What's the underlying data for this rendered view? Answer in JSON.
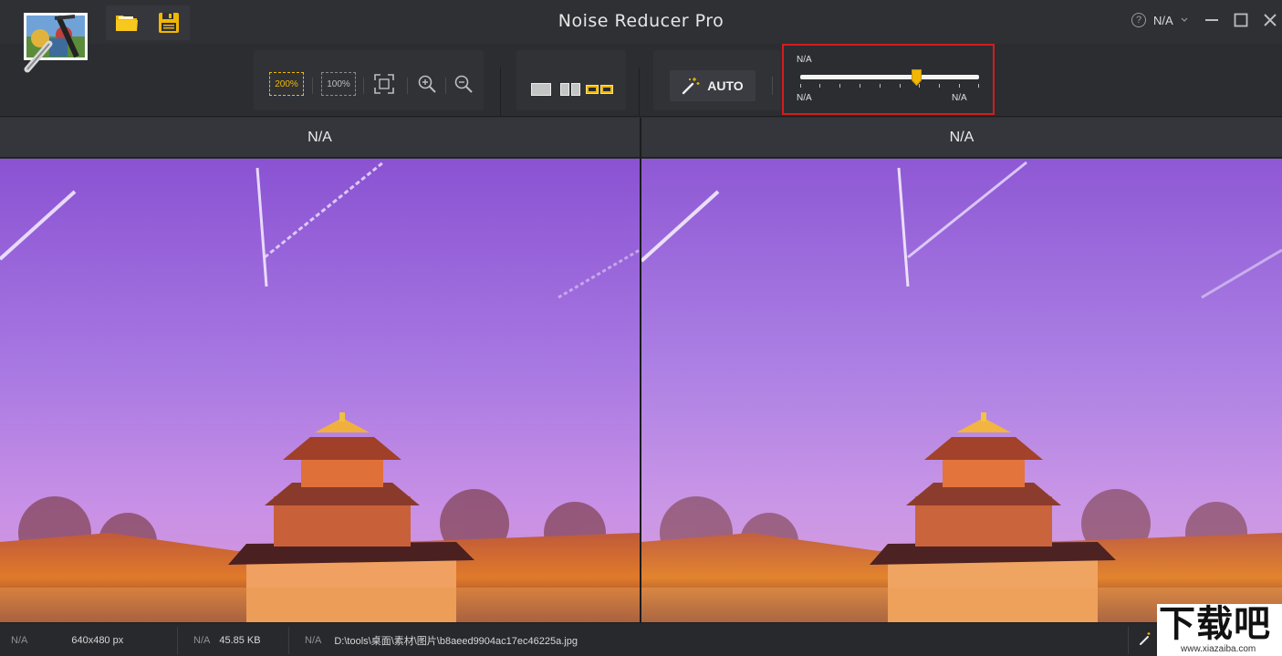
{
  "window": {
    "title": "Noise Reducer Pro",
    "help_label": "N/A",
    "help_symbol": "?"
  },
  "toolbar": {
    "zoom_200_label": "200%",
    "zoom_100_label": "100%",
    "auto_label": "AUTO"
  },
  "slider": {
    "top_label": "N/A",
    "min_label": "N/A",
    "max_label": "N/A",
    "value_fraction": 0.65
  },
  "panels": {
    "left_title": "N/A",
    "right_title": "N/A"
  },
  "status": {
    "dimensions_label": "N/A",
    "dimensions_value": "640x480 px",
    "size_label": "N/A",
    "size_value": "45.85 KB",
    "path_label": "N/A",
    "path_value": "D:\\tools\\桌面\\素材\\图片\\b8aeed9904ac17ec46225a.jpg"
  },
  "watermark": {
    "brand": "下载吧",
    "url": "www.xiazaiba.com"
  },
  "colors": {
    "accent": "#f2b705",
    "highlight_border": "#d21e1e",
    "background": "#2b2d31"
  }
}
